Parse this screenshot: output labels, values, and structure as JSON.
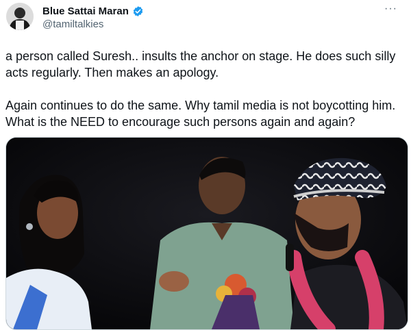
{
  "tweet": {
    "author_name": "Blue Sattai Maran",
    "author_handle": "@tamiltalkies",
    "verified": true,
    "more_icon": "more-horizontal-icon",
    "text_paragraphs": [
      "a person called Suresh.. insults the anchor on stage. He does such silly acts regularly. Then makes an apology.",
      "Again continues to do the same. Why tamil media is not boycotting him. What is the NEED to encourage such persons again and again?"
    ],
    "media": {
      "type": "video-still",
      "description_icon": "video-thumbnail-icon"
    }
  },
  "colors": {
    "text_primary": "#0f1419",
    "text_secondary": "#536471",
    "verified_blue": "#1d9bf0",
    "border": "#cfd9de"
  }
}
